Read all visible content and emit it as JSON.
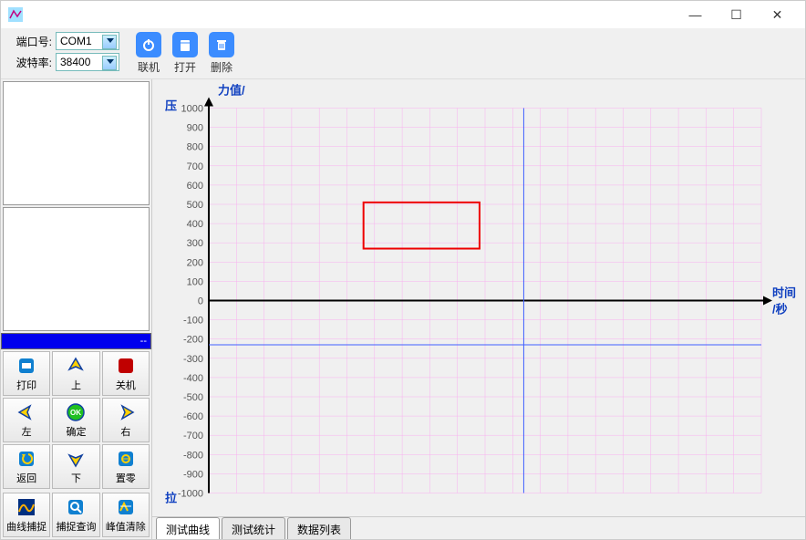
{
  "window": {
    "minimize": "—",
    "maximize": "☐",
    "close": "✕"
  },
  "port": {
    "port_label": "端口号:",
    "port_value": "COM1",
    "baud_label": "波特率:",
    "baud_value": "38400"
  },
  "actions": {
    "connect": "联机",
    "open": "打开",
    "delete": "删除"
  },
  "blue_bar_text": "--",
  "grid_buttons": {
    "print": "打印",
    "up": "上",
    "power": "关机",
    "left": "左",
    "ok": "确定",
    "right": "右",
    "back": "返回",
    "down": "下",
    "zero": "置零"
  },
  "bottom_buttons": {
    "capture": "曲线捕捉",
    "query": "捕捉查询",
    "peak_clear": "峰值清除"
  },
  "tabs": {
    "curve": "测试曲线",
    "stats": "测试统计",
    "table": "数据列表"
  },
  "chart_data": {
    "type": "line",
    "title_y": "力值/",
    "title_x_top": "时间",
    "title_x_bottom": "/秒",
    "label_top": "压",
    "label_bottom": "拉",
    "y_ticks": [
      1000,
      900,
      800,
      700,
      600,
      500,
      400,
      300,
      200,
      100,
      0,
      -100,
      -200,
      -300,
      -400,
      -500,
      -600,
      -700,
      -800,
      -900,
      -1000
    ],
    "ylim": [
      -1000,
      1000
    ],
    "x_range": [
      0,
      100
    ],
    "vertical_guide_x": 57,
    "horizontal_guide_y": -230,
    "selection_box": {
      "x0": 28,
      "x1": 49,
      "y0": 270,
      "y1": 510
    },
    "series": []
  }
}
